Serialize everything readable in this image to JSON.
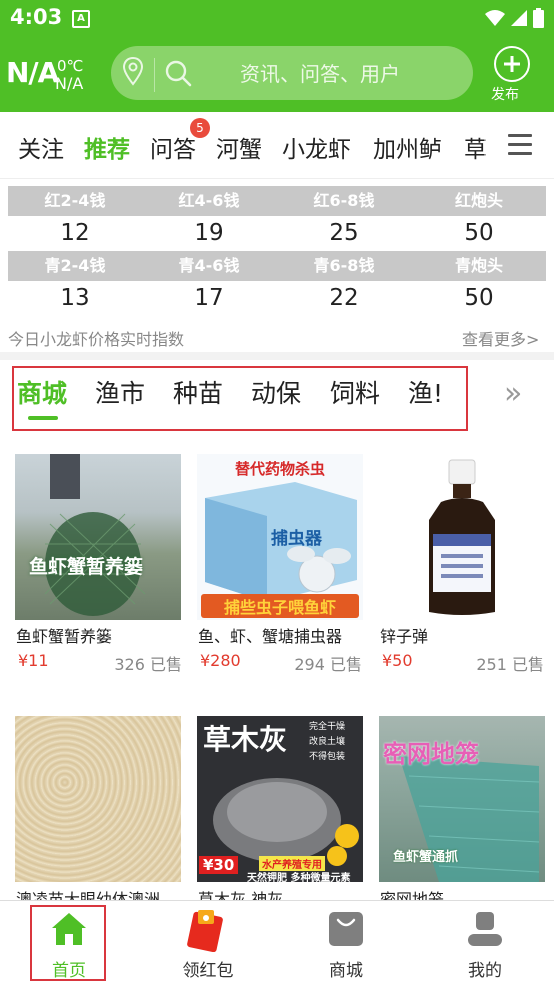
{
  "status": {
    "time": "4:03",
    "a_icon": "A"
  },
  "header": {
    "weather_main": "N/A",
    "weather_temp": "0℃",
    "weather_cond": "N/A",
    "search_placeholder": "资讯、问答、用户",
    "publish_label": "发布",
    "accent": "#4fbf26"
  },
  "categories": [
    "关注",
    "推荐",
    "问答",
    "河蟹",
    "小龙虾",
    "加州鲈",
    "草"
  ],
  "categories_active": "推荐",
  "qa_badge": "5",
  "prices": {
    "row1_labels": [
      "红2-4钱",
      "红4-6钱",
      "红6-8钱",
      "红炮头"
    ],
    "row1_values": [
      "12",
      "19",
      "25",
      "50"
    ],
    "row2_labels": [
      "青2-4钱",
      "青4-6钱",
      "青6-8钱",
      "青炮头"
    ],
    "row2_values": [
      "13",
      "17",
      "22",
      "50"
    ],
    "note": "今日小龙虾价格实时指数",
    "more": "查看更多>"
  },
  "shop_tabs": [
    "商城",
    "渔市",
    "种苗",
    "动保",
    "饲料",
    "渔!"
  ],
  "shop_more": "»",
  "products": [
    {
      "name": "鱼虾蟹暂养篓",
      "price": "¥11",
      "sold": "326 已售",
      "img_text": "鱼虾蟹暂养篓"
    },
    {
      "name": "鱼、虾、蟹塘捕虫器",
      "price": "¥280",
      "sold": "294 已售",
      "img_top": "替代药物杀虫",
      "img_mid": "捕虫器",
      "img_bottom": "捕些虫子喂鱼虾"
    },
    {
      "name": "锌子弹",
      "price": "¥50",
      "sold": "251 已售"
    },
    {
      "name": "澳凌苗大眼幼体澳洲淡水龙虾",
      "img_text": ""
    },
    {
      "name": "草木灰 神灰",
      "img_title": "草木灰",
      "img_price": "¥30",
      "img_tags": [
        "完全干燥",
        "改良土壤",
        "不得包装"
      ],
      "img_band1": "水产养殖专用",
      "img_band2": "天然钾肥 多种微量元素"
    },
    {
      "name": "密网地笼",
      "img_title": "密网地笼",
      "img_sub": "鱼虾蟹通抓"
    }
  ],
  "nav": [
    {
      "label": "首页",
      "icon": "home-icon"
    },
    {
      "label": "领红包",
      "icon": "red-envelope-icon"
    },
    {
      "label": "商城",
      "icon": "shopping-bag-icon"
    },
    {
      "label": "我的",
      "icon": "user-icon"
    }
  ]
}
